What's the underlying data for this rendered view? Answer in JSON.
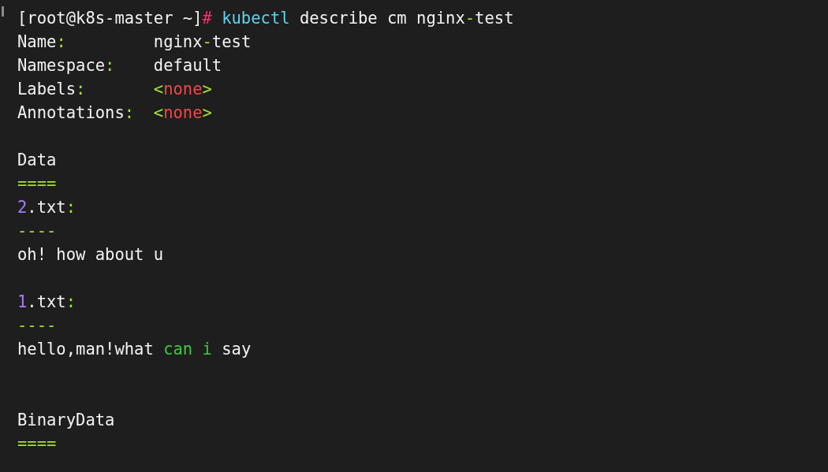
{
  "terminal": {
    "lines": [
      {
        "kind": "text",
        "segments": [
          {
            "kind": "plain",
            "text": "[root@k8s-master ~]"
          },
          {
            "kind": "prompt",
            "text": "# "
          },
          {
            "kind": "command",
            "text": "kubectl"
          },
          {
            "kind": "plain",
            "text": " describe cm nginx"
          },
          {
            "kind": "punct",
            "text": "-"
          },
          {
            "kind": "plain",
            "text": "test"
          }
        ]
      },
      {
        "kind": "text",
        "segments": [
          {
            "kind": "plain",
            "text": "Name"
          },
          {
            "kind": "punct",
            "text": ":"
          },
          {
            "kind": "plain",
            "text": "         nginx"
          },
          {
            "kind": "punct",
            "text": "-"
          },
          {
            "kind": "plain",
            "text": "test"
          }
        ]
      },
      {
        "kind": "text",
        "segments": [
          {
            "kind": "plain",
            "text": "Namespace"
          },
          {
            "kind": "punct",
            "text": ":"
          },
          {
            "kind": "plain",
            "text": "    default"
          }
        ]
      },
      {
        "kind": "text",
        "segments": [
          {
            "kind": "plain",
            "text": "Labels"
          },
          {
            "kind": "punct",
            "text": ":       <"
          },
          {
            "kind": "null",
            "text": "none"
          },
          {
            "kind": "punct",
            "text": ">"
          }
        ]
      },
      {
        "kind": "text",
        "segments": [
          {
            "kind": "plain",
            "text": "Annotations"
          },
          {
            "kind": "punct",
            "text": ":  <"
          },
          {
            "kind": "null",
            "text": "none"
          },
          {
            "kind": "punct",
            "text": ">"
          }
        ]
      },
      {
        "kind": "blank"
      },
      {
        "kind": "text",
        "segments": [
          {
            "kind": "plain",
            "text": "Data"
          }
        ]
      },
      {
        "kind": "text",
        "segments": [
          {
            "kind": "punct",
            "text": "===="
          }
        ]
      },
      {
        "kind": "text",
        "segments": [
          {
            "kind": "number",
            "text": "2"
          },
          {
            "kind": "plain",
            "text": ".txt"
          },
          {
            "kind": "punct",
            "text": ":"
          }
        ]
      },
      {
        "kind": "text",
        "segments": [
          {
            "kind": "punct",
            "text": "----"
          }
        ]
      },
      {
        "kind": "text",
        "segments": [
          {
            "kind": "plain",
            "text": "oh! how about u"
          }
        ]
      },
      {
        "kind": "blank"
      },
      {
        "kind": "text",
        "segments": [
          {
            "kind": "number",
            "text": "1"
          },
          {
            "kind": "plain",
            "text": ".txt"
          },
          {
            "kind": "punct",
            "text": ":"
          }
        ]
      },
      {
        "kind": "text",
        "segments": [
          {
            "kind": "punct",
            "text": "----"
          }
        ]
      },
      {
        "kind": "text",
        "segments": [
          {
            "kind": "plain",
            "text": "hello,man!what "
          },
          {
            "kind": "keyword",
            "text": "can i"
          },
          {
            "kind": "plain",
            "text": " say"
          }
        ]
      },
      {
        "kind": "blank"
      },
      {
        "kind": "blank"
      },
      {
        "kind": "text",
        "segments": [
          {
            "kind": "plain",
            "text": "BinaryData"
          }
        ]
      },
      {
        "kind": "text",
        "segments": [
          {
            "kind": "punct",
            "text": "===="
          }
        ]
      }
    ]
  }
}
